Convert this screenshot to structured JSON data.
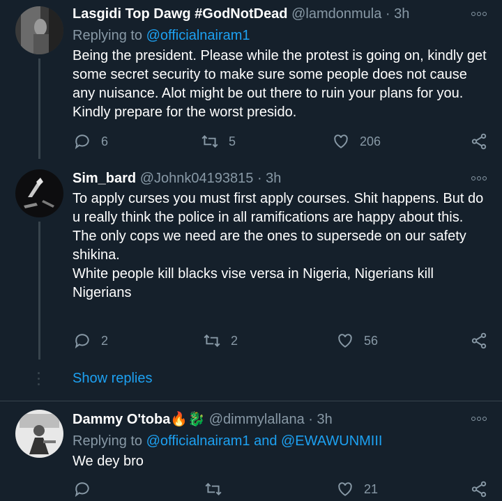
{
  "tweets": [
    {
      "name": "Lasgidi Top Dawg #GodNotDead",
      "handle": "@lamdonmula",
      "time": "· 3h",
      "replying_label": "Replying to ",
      "replying_to": "@officialnairam1",
      "text": "Being the president. Please while the protest is going on, kindly get some secret security to make sure some people does not cause any nuisance. Alot might be out there to ruin your plans for you. Kindly prepare for the worst presido.",
      "replies": "6",
      "retweets": "5",
      "likes": "206"
    },
    {
      "name": "Sim_bard",
      "handle": "@Johnk04193815",
      "time": "· 3h",
      "text": "To apply curses you must first apply courses. Shit happens. But do u really think the police in all ramifications are happy about this.\nThe only cops we need are the ones to supersede on our safety shikina.\nWhite people kill blacks vise versa in Nigeria, Nigerians kill Nigerians",
      "replies": "2",
      "retweets": "2",
      "likes": "56"
    },
    {
      "name": "Dammy O'toba🔥🐉",
      "handle": "@dimmylallana",
      "time": "· 3h",
      "replying_label": "Replying to ",
      "replying_to": "@officialnairam1 and @EWAWUNMIII",
      "text": "We dey bro",
      "replies": "",
      "retweets": "",
      "likes": "21"
    }
  ],
  "show_replies": "Show replies",
  "colors": {
    "background": "#15202b",
    "muted": "#8899a6",
    "link": "#1da1f2",
    "divider": "#38444d"
  },
  "icons": [
    "reply-icon",
    "retweet-icon",
    "like-icon",
    "share-icon",
    "more-icon"
  ]
}
